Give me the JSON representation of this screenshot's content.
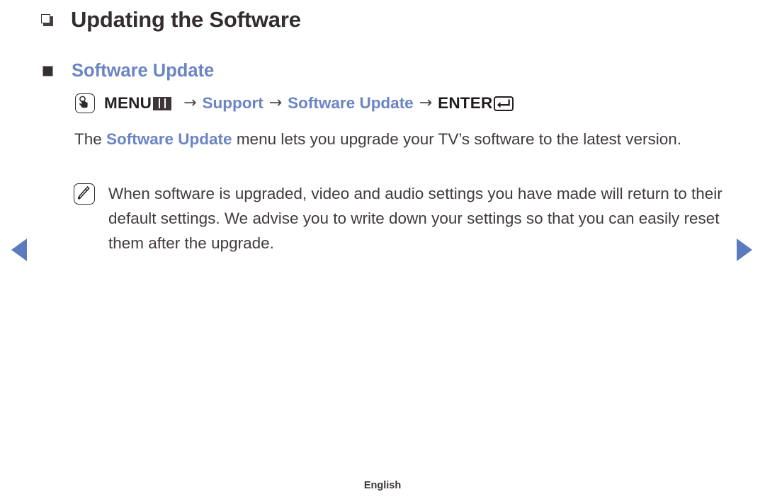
{
  "chapter": {
    "bullet_icon": "hollow-square-bullet",
    "title": "Updating the Software"
  },
  "section": {
    "bullet_icon": "filled-square-bullet",
    "title": "Software Update"
  },
  "menu_path": {
    "oo_icon": "hand-press-button-icon",
    "menu_label": "MENU",
    "menu_glyph_icon": "menu-bars-icon",
    "arrow": "→",
    "step_support": "Support",
    "step_software_update": "Software Update",
    "enter_label": "ENTER",
    "enter_glyph_icon": "enter-return-key-icon"
  },
  "body": {
    "lead": "The ",
    "highlight": "Software Update",
    "rest": " menu lets you upgrade your TV’s software to the latest version."
  },
  "note": {
    "icon": "note-pencil-icon",
    "text": "When software is upgraded, video and audio settings you have made will return to their default settings. We advise you to write down your settings so that you can easily reset them after the upgrade."
  },
  "navigation": {
    "prev_icon": "triangle-left-icon",
    "next_icon": "triangle-right-icon",
    "arrow_color": "#5b7bbf"
  },
  "footer": {
    "language": "English"
  },
  "colors": {
    "accent_blue": "#6b85c4",
    "nav_blue": "#5b7bbf",
    "text": "#413a3f",
    "background": "#ffffff"
  }
}
